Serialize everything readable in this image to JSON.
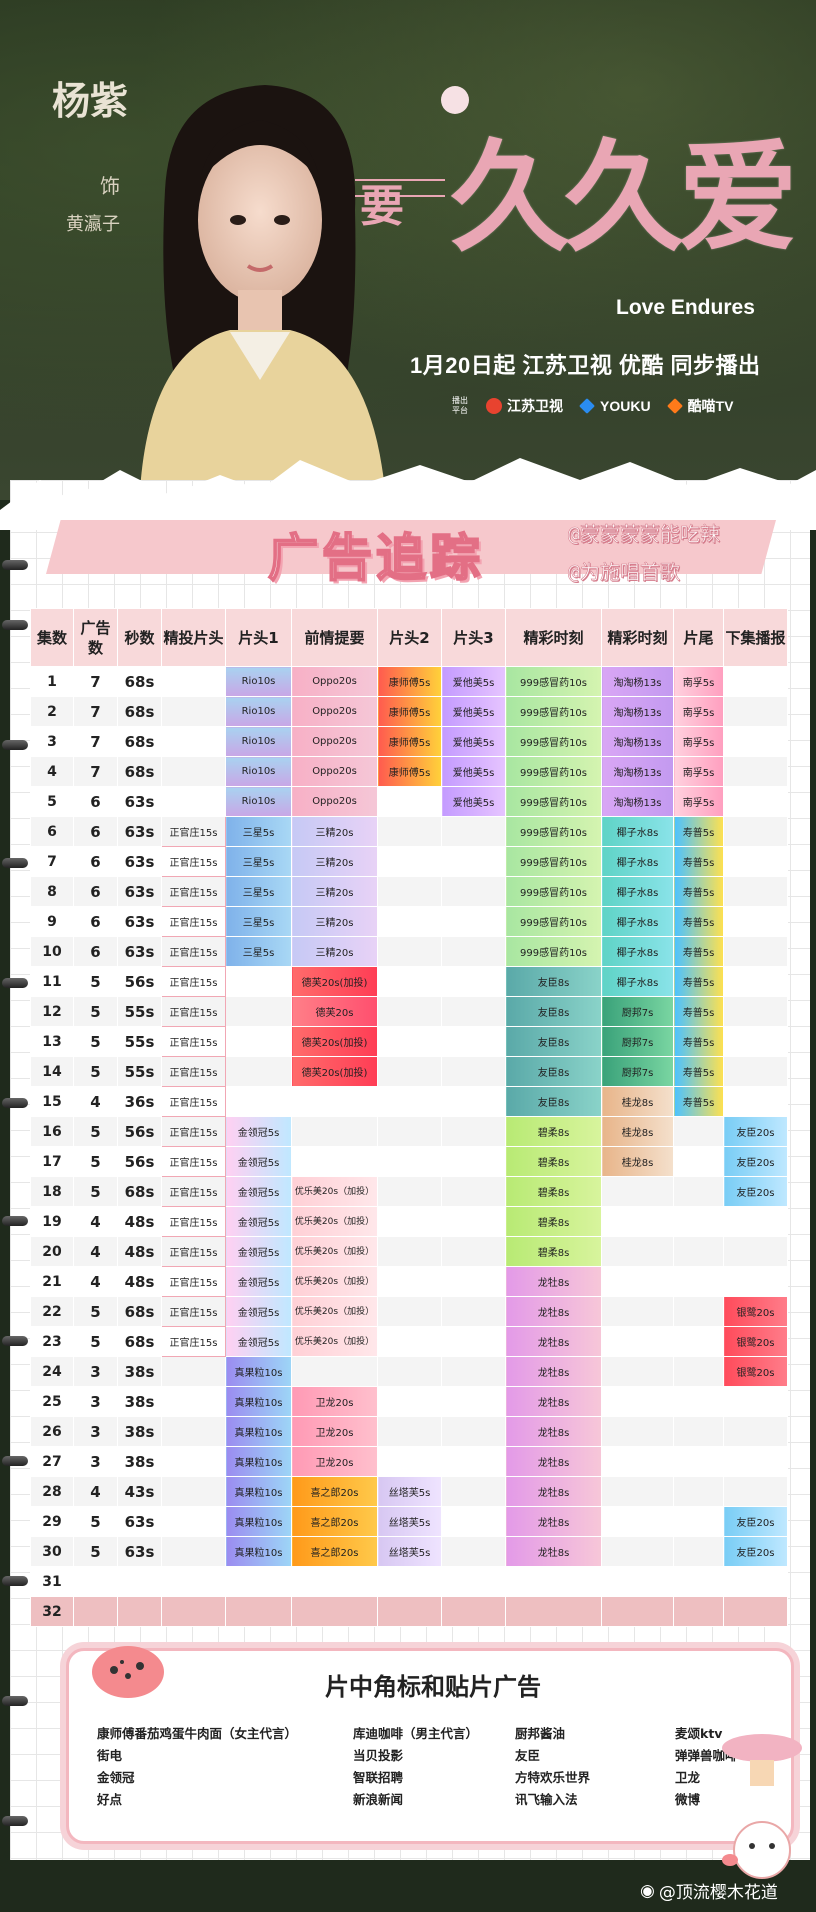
{
  "poster": {
    "actor": "杨紫",
    "role_label": "饰",
    "role_name": "黄瀛子",
    "title_small": "要",
    "title_main": "久久爱",
    "title_en": "Love Endures",
    "air_line": "1月20日起 江苏卫视 优酷 同步播出",
    "platform_label": "播出平台",
    "platforms": [
      {
        "name": "江苏卫视",
        "color": "#e8432f"
      },
      {
        "name": "YOUKU",
        "color": "#2a8cf0"
      },
      {
        "name": "酷喵TV",
        "color": "#ff7a1a"
      }
    ]
  },
  "tracking": {
    "title": "广告追踪",
    "credit1": "@蒙蒙蒙蒙能吃辣",
    "credit2": "@为施唱首歌"
  },
  "table": {
    "headers": [
      "集数",
      "广告数",
      "秒数",
      "精投片头",
      "片头1",
      "前情提要",
      "片头2",
      "片头3",
      "精彩时刻",
      "精彩时刻",
      "片尾",
      "下集播报"
    ],
    "rows": [
      [
        "1",
        "7",
        "68s",
        "",
        "Rio10s",
        "Oppo20s",
        "康师傅5s",
        "爱他美5s",
        "999感冒药10s",
        "淘淘杨13s",
        "南孚5s",
        ""
      ],
      [
        "2",
        "7",
        "68s",
        "",
        "Rio10s",
        "Oppo20s",
        "康师傅5s",
        "爱他美5s",
        "999感冒药10s",
        "淘淘杨13s",
        "南孚5s",
        ""
      ],
      [
        "3",
        "7",
        "68s",
        "",
        "Rio10s",
        "Oppo20s",
        "康师傅5s",
        "爱他美5s",
        "999感冒药10s",
        "淘淘杨13s",
        "南孚5s",
        ""
      ],
      [
        "4",
        "7",
        "68s",
        "",
        "Rio10s",
        "Oppo20s",
        "康师傅5s",
        "爱他美5s",
        "999感冒药10s",
        "淘淘杨13s",
        "南孚5s",
        ""
      ],
      [
        "5",
        "6",
        "63s",
        "",
        "Rio10s",
        "Oppo20s",
        "",
        "爱他美5s",
        "999感冒药10s",
        "淘淘杨13s",
        "南孚5s",
        ""
      ],
      [
        "6",
        "6",
        "63s",
        "正官庄15s",
        "三星5s",
        "三精20s",
        "",
        "",
        "999感冒药10s",
        "椰子水8s",
        "寿普5s",
        ""
      ],
      [
        "7",
        "6",
        "63s",
        "正官庄15s",
        "三星5s",
        "三精20s",
        "",
        "",
        "999感冒药10s",
        "椰子水8s",
        "寿普5s",
        ""
      ],
      [
        "8",
        "6",
        "63s",
        "正官庄15s",
        "三星5s",
        "三精20s",
        "",
        "",
        "999感冒药10s",
        "椰子水8s",
        "寿普5s",
        ""
      ],
      [
        "9",
        "6",
        "63s",
        "正官庄15s",
        "三星5s",
        "三精20s",
        "",
        "",
        "999感冒药10s",
        "椰子水8s",
        "寿普5s",
        ""
      ],
      [
        "10",
        "6",
        "63s",
        "正官庄15s",
        "三星5s",
        "三精20s",
        "",
        "",
        "999感冒药10s",
        "椰子水8s",
        "寿普5s",
        ""
      ],
      [
        "11",
        "5",
        "56s",
        "正官庄15s",
        "",
        "德芙20s(加投)",
        "",
        "",
        "友臣8s",
        "椰子水8s",
        "寿普5s",
        ""
      ],
      [
        "12",
        "5",
        "55s",
        "正官庄15s",
        "",
        "德芙20s",
        "",
        "",
        "友臣8s",
        "厨邦7s",
        "寿普5s",
        ""
      ],
      [
        "13",
        "5",
        "55s",
        "正官庄15s",
        "",
        "德芙20s(加投)",
        "",
        "",
        "友臣8s",
        "厨邦7s",
        "寿普5s",
        ""
      ],
      [
        "14",
        "5",
        "55s",
        "正官庄15s",
        "",
        "德芙20s(加投)",
        "",
        "",
        "友臣8s",
        "厨邦7s",
        "寿普5s",
        ""
      ],
      [
        "15",
        "4",
        "36s",
        "正官庄15s",
        "",
        "",
        "",
        "",
        "友臣8s",
        "桂龙8s",
        "寿普5s",
        ""
      ],
      [
        "16",
        "5",
        "56s",
        "正官庄15s",
        "金领冠5s",
        "",
        "",
        "",
        "碧柔8s",
        "桂龙8s",
        "",
        "友臣20s"
      ],
      [
        "17",
        "5",
        "56s",
        "正官庄15s",
        "金领冠5s",
        "",
        "",
        "",
        "碧柔8s",
        "桂龙8s",
        "",
        "友臣20s"
      ],
      [
        "18",
        "5",
        "68s",
        "正官庄15s",
        "金领冠5s",
        "优乐美20s（加投）",
        "",
        "",
        "碧柔8s",
        "",
        "",
        "友臣20s"
      ],
      [
        "19",
        "4",
        "48s",
        "正官庄15s",
        "金领冠5s",
        "优乐美20s（加投）",
        "",
        "",
        "碧柔8s",
        "",
        "",
        ""
      ],
      [
        "20",
        "4",
        "48s",
        "正官庄15s",
        "金领冠5s",
        "优乐美20s（加投）",
        "",
        "",
        "碧柔8s",
        "",
        "",
        ""
      ],
      [
        "21",
        "4",
        "48s",
        "正官庄15s",
        "金领冠5s",
        "优乐美20s（加投）",
        "",
        "",
        "龙牡8s",
        "",
        "",
        ""
      ],
      [
        "22",
        "5",
        "68s",
        "正官庄15s",
        "金领冠5s",
        "优乐美20s（加投）",
        "",
        "",
        "龙牡8s",
        "",
        "",
        "银鹭20s"
      ],
      [
        "23",
        "5",
        "68s",
        "正官庄15s",
        "金领冠5s",
        "优乐美20s（加投）",
        "",
        "",
        "龙牡8s",
        "",
        "",
        "银鹭20s"
      ],
      [
        "24",
        "3",
        "38s",
        "",
        "真果粒10s",
        "",
        "",
        "",
        "龙牡8s",
        "",
        "",
        "银鹭20s"
      ],
      [
        "25",
        "3",
        "38s",
        "",
        "真果粒10s",
        "卫龙20s",
        "",
        "",
        "龙牡8s",
        "",
        "",
        ""
      ],
      [
        "26",
        "3",
        "38s",
        "",
        "真果粒10s",
        "卫龙20s",
        "",
        "",
        "龙牡8s",
        "",
        "",
        ""
      ],
      [
        "27",
        "3",
        "38s",
        "",
        "真果粒10s",
        "卫龙20s",
        "",
        "",
        "龙牡8s",
        "",
        "",
        ""
      ],
      [
        "28",
        "4",
        "43s",
        "",
        "真果粒10s",
        "喜之郎20s",
        "丝塔芙5s",
        "",
        "龙牡8s",
        "",
        "",
        ""
      ],
      [
        "29",
        "5",
        "63s",
        "",
        "真果粒10s",
        "喜之郎20s",
        "丝塔芙5s",
        "",
        "龙牡8s",
        "",
        "",
        "友臣20s"
      ],
      [
        "30",
        "5",
        "63s",
        "",
        "真果粒10s",
        "喜之郎20s",
        "丝塔芙5s",
        "",
        "龙牡8s",
        "",
        "",
        "友臣20s"
      ],
      [
        "31",
        "",
        "",
        "",
        "",
        "",
        "",
        "",
        "",
        "",
        "",
        ""
      ],
      [
        "32",
        "",
        "",
        "",
        "",
        "",
        "",
        "",
        "",
        "",
        "",
        ""
      ]
    ]
  },
  "bottom": {
    "title": "片中角标和贴片广告",
    "items": [
      "康师傅番茄鸡蛋牛肉面（女主代言）",
      "库迪咖啡（男主代言）",
      "厨邦酱油",
      "麦颂ktv",
      "街电",
      "当贝投影",
      "友臣",
      "弹弹兽咖啡",
      "金领冠",
      "智联招聘",
      "方特欢乐世界",
      "卫龙",
      "好点",
      "新浪新闻",
      "讯飞输入法",
      "微博"
    ]
  },
  "watermark": "@顶流樱木花道"
}
